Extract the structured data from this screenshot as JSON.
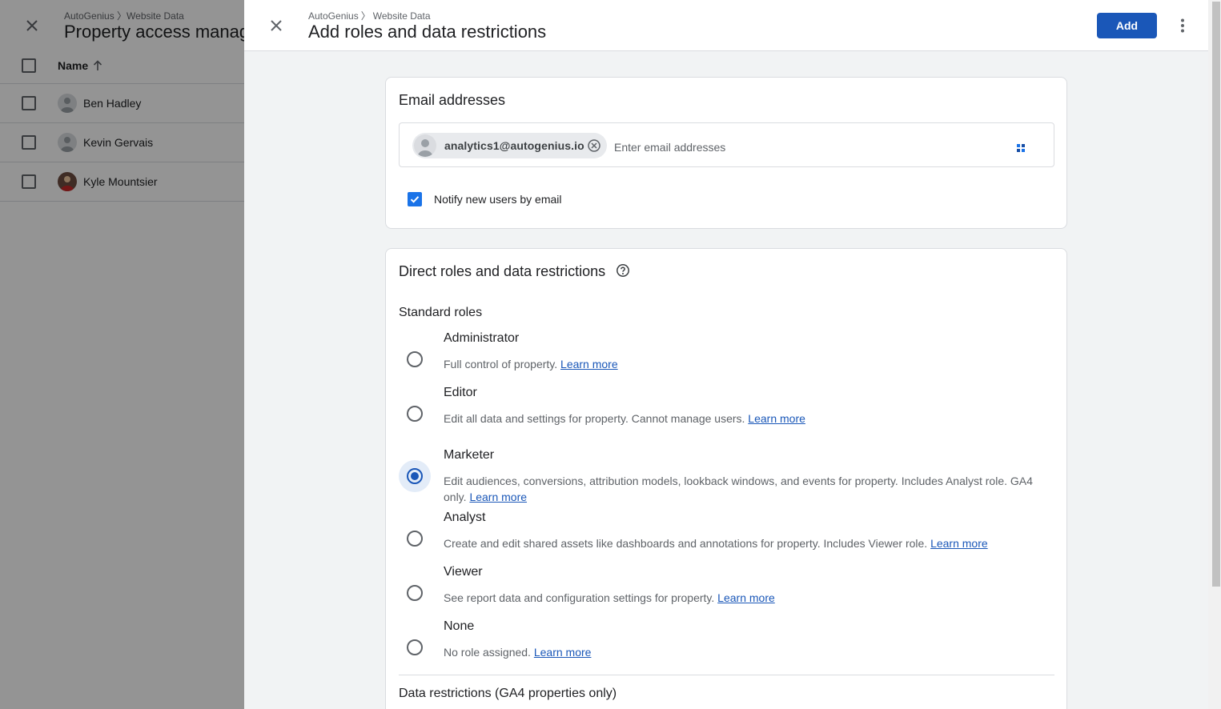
{
  "background": {
    "breadcrumb": "AutoGenius 〉Website Data",
    "title": "Property access management",
    "table": {
      "header_name": "Name",
      "rows": [
        {
          "name": "Ben Hadley",
          "avatar": "default-avatar-icon"
        },
        {
          "name": "Kevin Gervais",
          "avatar": "default-avatar-icon"
        },
        {
          "name": "Kyle Mountsier",
          "avatar": "photo-avatar"
        }
      ]
    }
  },
  "drawer": {
    "breadcrumb": {
      "account": "AutoGenius",
      "separator": "〉",
      "property": "Website Data"
    },
    "title": "Add roles and data restrictions",
    "add_label": "Add",
    "email_section": {
      "title": "Email addresses",
      "chips": [
        {
          "email": "analytics1@autogenius.io"
        }
      ],
      "input_value": "",
      "input_placeholder": "Enter email addresses",
      "notify_label": "Notify new users by email",
      "notify_checked": true
    },
    "roles_section": {
      "title": "Direct roles and data restrictions",
      "subtitle": "Standard roles",
      "learn_more": "Learn more",
      "roles": [
        {
          "name": "Administrator",
          "desc": "Full control of property.",
          "selected": false
        },
        {
          "name": "Editor",
          "desc": "Edit all data and settings for property. Cannot manage users.",
          "selected": false
        },
        {
          "name": "Marketer",
          "desc": "Edit audiences, conversions, attribution models, lookback windows, and events for property. Includes Analyst role. GA4 only.",
          "selected": true
        },
        {
          "name": "Analyst",
          "desc": "Create and edit shared assets like dashboards and annotations for property. Includes Viewer role.",
          "selected": false
        },
        {
          "name": "Viewer",
          "desc": "See report data and configuration settings for property.",
          "selected": false
        },
        {
          "name": "None",
          "desc": "No role assigned.",
          "selected": false
        }
      ],
      "data_restrictions_title": "Data restrictions (GA4 properties only)"
    }
  },
  "colors": {
    "primary": "#1a57b8",
    "checkbox": "#1a73e8",
    "panel_bg": "#f1f3f4",
    "scrim": "rgba(0,0,0,0.42)"
  }
}
